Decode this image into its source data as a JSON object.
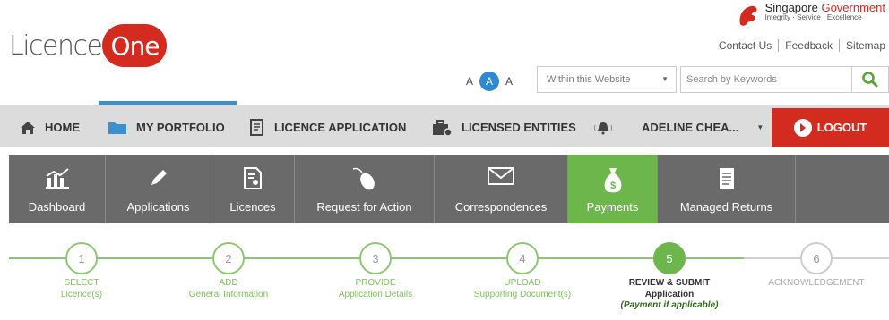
{
  "header": {
    "logo_part1": "Licence",
    "logo_part2": "One",
    "gov_title_part1": "Singapore ",
    "gov_title_part2": "Government",
    "gov_tagline": "Integrity · Service · Excellence",
    "links": [
      "Contact Us",
      "Feedback",
      "Sitemap"
    ],
    "font_size_small": "A",
    "font_size_medium": "A",
    "font_size_large": "A",
    "search_scope": "Within this Website",
    "search_placeholder": "Search by Keywords"
  },
  "nav": {
    "home": "HOME",
    "portfolio": "MY PORTFOLIO",
    "licence_application": "LICENCE APPLICATION",
    "licensed_entities": "LICENSED ENTITIES",
    "user": "ADELINE CHEA...",
    "logout": "LOGOUT",
    "active": "MY PORTFOLIO"
  },
  "tiles": [
    {
      "label": "Dashboard",
      "icon": "bar-chart-icon"
    },
    {
      "label": "Applications",
      "icon": "pencil-icon"
    },
    {
      "label": "Licences",
      "icon": "certificate-icon"
    },
    {
      "label": "Request for Action",
      "icon": "mouse-icon"
    },
    {
      "label": "Correspondences",
      "icon": "envelope-icon"
    },
    {
      "label": "Payments",
      "icon": "money-bag-icon",
      "active": true
    },
    {
      "label": "Managed Returns",
      "icon": "document-icon"
    }
  ],
  "steps": [
    {
      "number": "1",
      "line1": "SELECT",
      "line2": "Licence(s)",
      "state": "done"
    },
    {
      "number": "2",
      "line1": "ADD",
      "line2": "General Information",
      "state": "done"
    },
    {
      "number": "3",
      "line1": "PROVIDE",
      "line2": "Application Details",
      "state": "done"
    },
    {
      "number": "4",
      "line1": "UPLOAD",
      "line2": "Supporting Document(s)",
      "state": "done"
    },
    {
      "number": "5",
      "line1": "REVIEW & SUBMIT",
      "line2": "Application",
      "line3": "(Payment if applicable)",
      "state": "current"
    },
    {
      "number": "6",
      "line1": "ACKNOWLEDGEMENT",
      "line2": "",
      "state": "future"
    }
  ],
  "colors": {
    "brand_red": "#d42b20",
    "active_green": "#6db64c",
    "accent_blue": "#3c8fd0",
    "tile_gray": "#6a6a6a"
  }
}
